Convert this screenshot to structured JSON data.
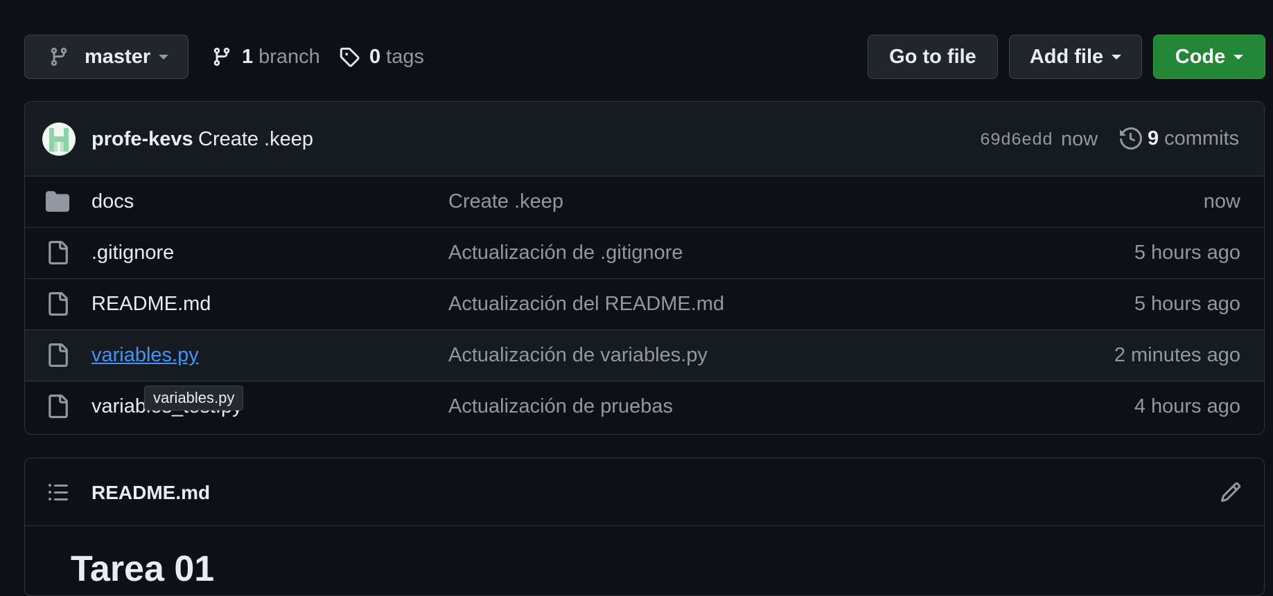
{
  "toolbar": {
    "branch_label": "master",
    "branches_count": "1",
    "branches_label": "branch",
    "tags_count": "0",
    "tags_label": "tags",
    "go_to_file_label": "Go to file",
    "add_file_label": "Add file",
    "code_label": "Code"
  },
  "latest_commit": {
    "author": "profe-kevs",
    "message": "Create .keep",
    "sha": "69d6edd",
    "time": "now",
    "commits_count": "9",
    "commits_label": "commits"
  },
  "files": [
    {
      "name": "docs",
      "type": "folder",
      "message": "Create .keep",
      "age": "now"
    },
    {
      "name": ".gitignore",
      "type": "file",
      "message": "Actualización de .gitignore",
      "age": "5 hours ago"
    },
    {
      "name": "README.md",
      "type": "file",
      "message": "Actualización del README.md",
      "age": "5 hours ago"
    },
    {
      "name": "variables.py",
      "type": "file",
      "message": "Actualización de variables.py",
      "age": "2 minutes ago"
    },
    {
      "name": "variables_test.py",
      "type": "file",
      "message": "Actualización de pruebas",
      "age": "4 hours ago"
    }
  ],
  "tooltip": "variables.py",
  "readme": {
    "filename": "README.md",
    "heading": "Tarea 01"
  },
  "colors": {
    "background": "#0d1117",
    "code_button": "#238636",
    "link_hover": "#4493f8"
  }
}
